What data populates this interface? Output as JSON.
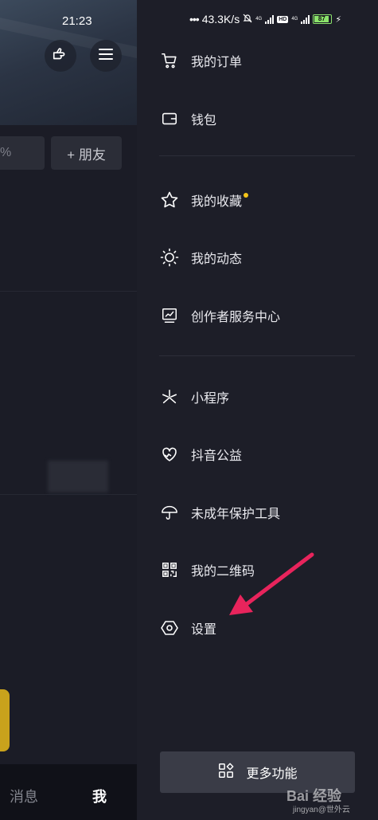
{
  "status_bar": {
    "time": "21:23",
    "network_speed": "43.3K/s",
    "network_type": "4G",
    "hd_label": "HD",
    "battery_level": "87"
  },
  "left_panel": {
    "search_partial": "%",
    "add_friend_label": "+ 朋友",
    "nav_messages": "消息",
    "nav_me": "我"
  },
  "drawer": {
    "group1": [
      {
        "label": "我的订单",
        "icon": "cart-icon"
      },
      {
        "label": "钱包",
        "icon": "wallet-icon"
      }
    ],
    "group2": [
      {
        "label": "我的收藏",
        "icon": "star-icon"
      },
      {
        "label": "我的动态",
        "icon": "sun-icon"
      },
      {
        "label": "创作者服务中心",
        "icon": "chart-monitor-icon"
      }
    ],
    "group3": [
      {
        "label": "小程序",
        "icon": "mini-program-icon"
      },
      {
        "label": "抖音公益",
        "icon": "heart-hand-icon"
      },
      {
        "label": "未成年保护工具",
        "icon": "umbrella-icon"
      },
      {
        "label": "我的二维码",
        "icon": "qr-code-icon"
      },
      {
        "label": "设置",
        "icon": "hexagon-settings-icon"
      }
    ],
    "more_functions_label": "更多功能"
  },
  "watermark": {
    "brand": "Bai 经验",
    "sub": "jingyan@世外云"
  },
  "colors": {
    "accent_dot": "#f5c518",
    "arrow": "#e8245c",
    "drawer_bg": "#1d1e28"
  }
}
